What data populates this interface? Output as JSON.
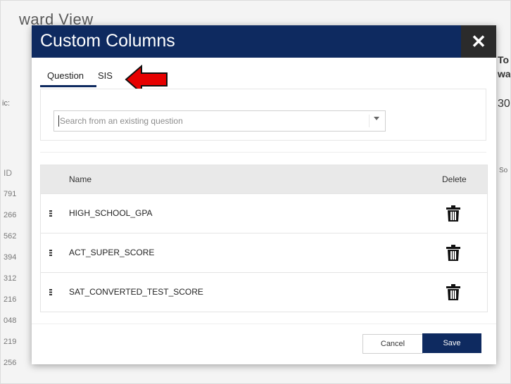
{
  "background": {
    "page_title_fragment": "ward View",
    "left_label_fragment": "ic:",
    "id_header": "ID",
    "id_fragments": [
      "791",
      "266",
      "562",
      "394",
      "312",
      "216",
      "048",
      "219",
      "256"
    ],
    "right_fragments": [
      "To",
      "wa",
      "30",
      "So"
    ]
  },
  "modal": {
    "title": "Custom Columns",
    "close_symbol": "✕",
    "tabs": [
      {
        "label": "Question",
        "active": true
      },
      {
        "label": "SIS",
        "active": false
      }
    ],
    "search": {
      "placeholder": "Search from an existing question"
    },
    "table": {
      "headers": {
        "name": "Name",
        "delete": "Delete"
      },
      "rows": [
        {
          "name": "HIGH_SCHOOL_GPA"
        },
        {
          "name": "ACT_SUPER_SCORE"
        },
        {
          "name": "SAT_CONVERTED_TEST_SCORE"
        }
      ]
    },
    "buttons": {
      "cancel": "Cancel",
      "save": "Save"
    }
  },
  "colors": {
    "header_bg": "#0e2a60",
    "close_bg": "#2b2b2b",
    "annotation_arrow": "#e60000"
  },
  "icons": [
    "close-icon",
    "dropdown-caret-icon",
    "drag-handle-icon",
    "trash-icon",
    "red-arrow-annotation"
  ]
}
